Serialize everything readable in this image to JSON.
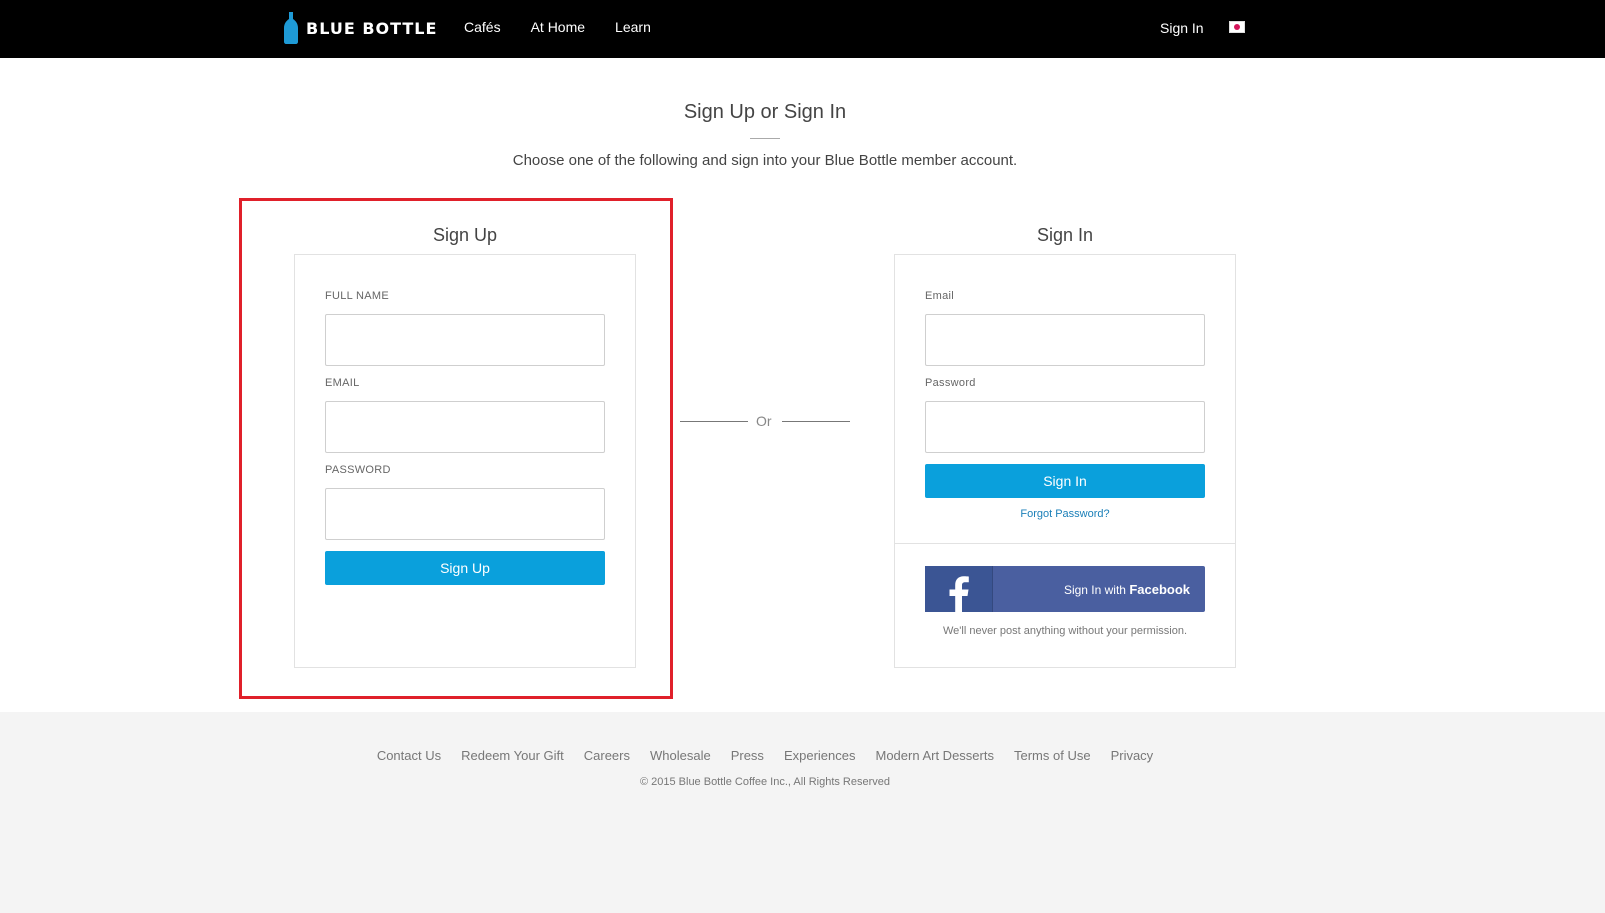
{
  "header": {
    "brand": "BLUE BOTTLE",
    "nav": [
      "Cafés",
      "At Home",
      "Learn"
    ],
    "signin_label": "Sign In",
    "flag_icon": "japan-flag-icon"
  },
  "intro": {
    "title": "Sign Up or Sign In",
    "subtitle": "Choose one of the following and sign into your Blue Bottle member account."
  },
  "signup": {
    "heading": "Sign Up",
    "full_name_label": "FULL NAME",
    "full_name_value": "",
    "email_label": "EMAIL",
    "email_value": "",
    "password_label": "PASSWORD",
    "password_value": "",
    "button_label": "Sign Up"
  },
  "separator": {
    "label": "Or"
  },
  "signin": {
    "heading": "Sign In",
    "email_label": "Email",
    "email_value": "",
    "password_label": "Password",
    "password_value": "",
    "button_label": "Sign In",
    "forgot_label": "Forgot Password?",
    "facebook_prefix": "Sign In with ",
    "facebook_brand": "Facebook",
    "facebook_note": "We'll never post anything without your permission."
  },
  "footer": {
    "links": [
      "Contact Us",
      "Redeem Your Gift",
      "Careers",
      "Wholesale",
      "Press",
      "Experiences",
      "Modern Art Desserts",
      "Terms of Use",
      "Privacy"
    ],
    "copyright": "© 2015 Blue Bottle Coffee Inc., All Rights Reserved"
  },
  "colors": {
    "accent": "#0aa0dc",
    "facebook": "#4a5fa0",
    "highlight": "#e0202a"
  }
}
